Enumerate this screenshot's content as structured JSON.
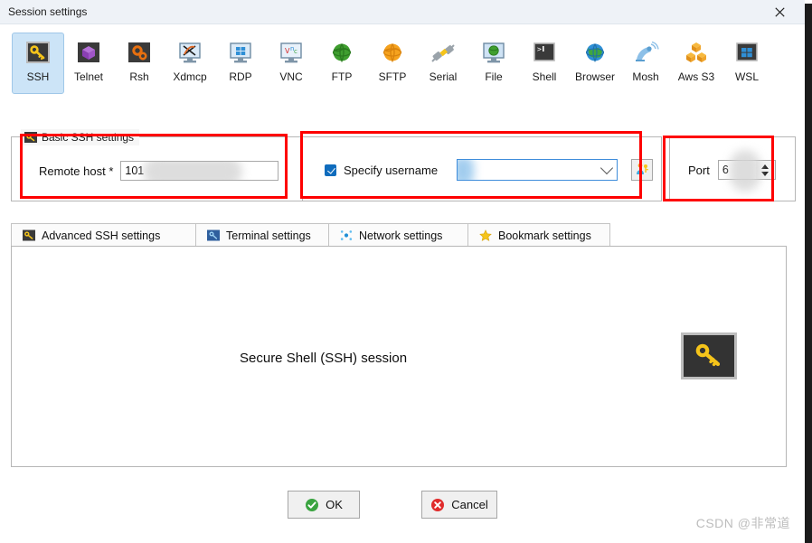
{
  "window": {
    "title": "Session settings",
    "close_label": "✕"
  },
  "session_types": [
    {
      "label": "SSH",
      "icon": "ssh-key-icon",
      "selected": true
    },
    {
      "label": "Telnet",
      "icon": "telnet-cube-icon",
      "selected": false
    },
    {
      "label": "Rsh",
      "icon": "rsh-gears-icon",
      "selected": false
    },
    {
      "label": "Xdmcp",
      "icon": "xdmcp-x-icon",
      "selected": false
    },
    {
      "label": "RDP",
      "icon": "rdp-monitor-icon",
      "selected": false
    },
    {
      "label": "VNC",
      "icon": "vnc-monitor-icon",
      "selected": false
    },
    {
      "label": "FTP",
      "icon": "ftp-globe-icon",
      "selected": false
    },
    {
      "label": "SFTP",
      "icon": "sftp-globe-icon",
      "selected": false
    },
    {
      "label": "Serial",
      "icon": "serial-plug-icon",
      "selected": false
    },
    {
      "label": "File",
      "icon": "file-monitor-icon",
      "selected": false
    },
    {
      "label": "Shell",
      "icon": "shell-prompt-icon",
      "selected": false
    },
    {
      "label": "Browser",
      "icon": "browser-globe-icon",
      "selected": false
    },
    {
      "label": "Mosh",
      "icon": "mosh-satellite-icon",
      "selected": false
    },
    {
      "label": "Aws S3",
      "icon": "aws-s3-cubes-icon",
      "selected": false
    },
    {
      "label": "WSL",
      "icon": "wsl-windows-icon",
      "selected": false
    }
  ],
  "basic_settings": {
    "group_title": "Basic SSH settings",
    "group_icon": "ssh-key-icon",
    "remote_host_label": "Remote host *",
    "remote_host_value": "101",
    "remote_host_redacted": true,
    "specify_username_label": "Specify username",
    "specify_username_checked": true,
    "username_value": "",
    "username_redacted": true,
    "username_browse_icon": "user-key-icon",
    "port_label": "Port",
    "port_value": "6",
    "port_redacted": true
  },
  "tabs": [
    {
      "label": "Advanced SSH settings",
      "icon": "ssh-key-icon"
    },
    {
      "label": "Terminal settings",
      "icon": "terminal-icon"
    },
    {
      "label": "Network settings",
      "icon": "network-dots-icon"
    },
    {
      "label": "Bookmark settings",
      "icon": "star-icon"
    }
  ],
  "content": {
    "title": "Secure Shell (SSH) session",
    "icon": "ssh-key-icon"
  },
  "footer": {
    "ok_label": "OK",
    "ok_icon": "green-check-icon",
    "cancel_label": "Cancel",
    "cancel_icon": "red-x-icon"
  },
  "watermark": "CSDN @非常道",
  "colors": {
    "annotation": "#fe0000",
    "selection": "#cce4f7",
    "combo_border": "#3f8ddb",
    "checkbox": "#0f6cbd",
    "ok_green": "#3aa440",
    "cancel_red": "#e02b2b",
    "key_yellow": "#f5c41a"
  }
}
